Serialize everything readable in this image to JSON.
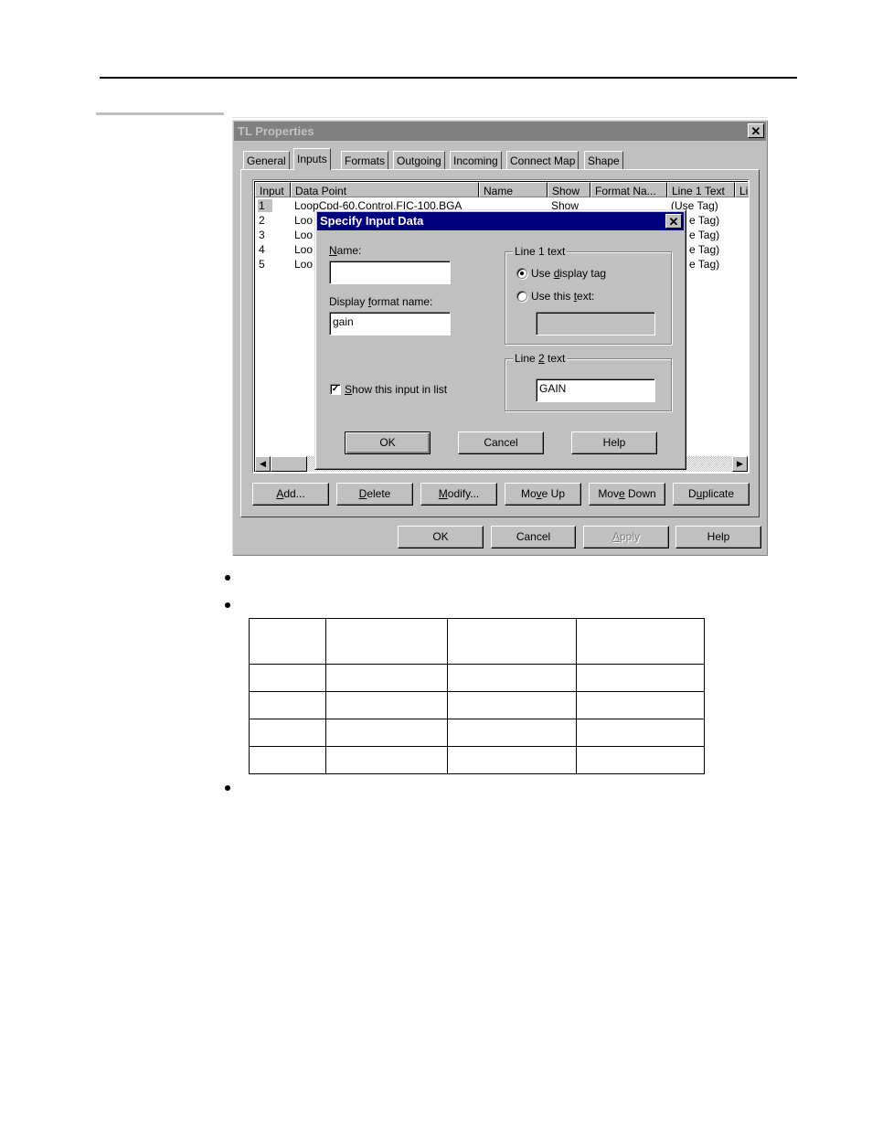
{
  "window": {
    "title": "TL Properties",
    "close_glyph": "✕",
    "tabs": [
      "General",
      "Inputs",
      "Formats",
      "Outgoing",
      "Incoming",
      "Connect Map",
      "Shape"
    ],
    "active_tab": "Inputs"
  },
  "inputs_list": {
    "columns": [
      "Input",
      "Data Point",
      "Name",
      "Show",
      "Format Na...",
      "Line 1 Text",
      "Li"
    ],
    "rows": [
      {
        "input": "1",
        "data_point": "LoopCpd-60.Control.FIC-100.BGA",
        "name": "",
        "show": "Show",
        "format": "",
        "line1": "(Use Tag)"
      },
      {
        "input": "2",
        "data_point": "Loo",
        "name": "",
        "show": "",
        "format": "",
        "line1": "e Tag)"
      },
      {
        "input": "3",
        "data_point": "Loo",
        "name": "",
        "show": "",
        "format": "",
        "line1": "e Tag)"
      },
      {
        "input": "4",
        "data_point": "Loo",
        "name": "",
        "show": "",
        "format": "",
        "line1": "e Tag)"
      },
      {
        "input": "5",
        "data_point": "Loo",
        "name": "",
        "show": "",
        "format": "",
        "line1": "e Tag)"
      }
    ],
    "scroll_left_glyph": "◀",
    "scroll_right_glyph": "▶"
  },
  "list_buttons": {
    "add": {
      "pre": "",
      "u": "A",
      "post": "dd..."
    },
    "delete": {
      "pre": "",
      "u": "D",
      "post": "elete"
    },
    "modify": {
      "pre": "",
      "u": "M",
      "post": "odify..."
    },
    "move_up": {
      "pre": "Mo",
      "u": "v",
      "post": "e Up"
    },
    "move_down": {
      "pre": "Mov",
      "u": "e",
      "post": " Down"
    },
    "duplicate": {
      "pre": "D",
      "u": "u",
      "post": "plicate"
    }
  },
  "window_buttons": {
    "ok": "OK",
    "cancel": "Cancel",
    "apply": {
      "pre": "",
      "u": "A",
      "post": "pply"
    },
    "help": "Help"
  },
  "dialog": {
    "title": "Specify Input Data",
    "name_label": {
      "pre": "",
      "u": "N",
      "post": "ame:"
    },
    "name_value": "",
    "format_label": {
      "pre": "Display ",
      "u": "f",
      "post": "ormat name:"
    },
    "format_value": "gain",
    "show_checkbox": {
      "pre": "",
      "u": "S",
      "post": "how this input in list",
      "checked": true
    },
    "line1_group": "Line 1 text",
    "line1_option1": {
      "pre": "Use ",
      "u": "d",
      "post": "isplay tag",
      "selected": true
    },
    "line1_option2": {
      "pre": "Use this ",
      "u": "t",
      "post": "ext:",
      "selected": false
    },
    "line1_custom_value": "",
    "line2_group": {
      "pre": "Line ",
      "u": "2",
      "post": " text"
    },
    "line2_value": "GAIN",
    "ok": "OK",
    "cancel": "Cancel",
    "help": "Help"
  },
  "document": {
    "bullets": 3,
    "table": {
      "rows": 5,
      "cols": 4,
      "cells": [
        [
          "",
          "",
          "",
          ""
        ],
        [
          "",
          "",
          "",
          ""
        ],
        [
          "",
          "",
          "",
          ""
        ],
        [
          "",
          "",
          "",
          ""
        ],
        [
          "",
          "",
          "",
          ""
        ]
      ]
    }
  }
}
